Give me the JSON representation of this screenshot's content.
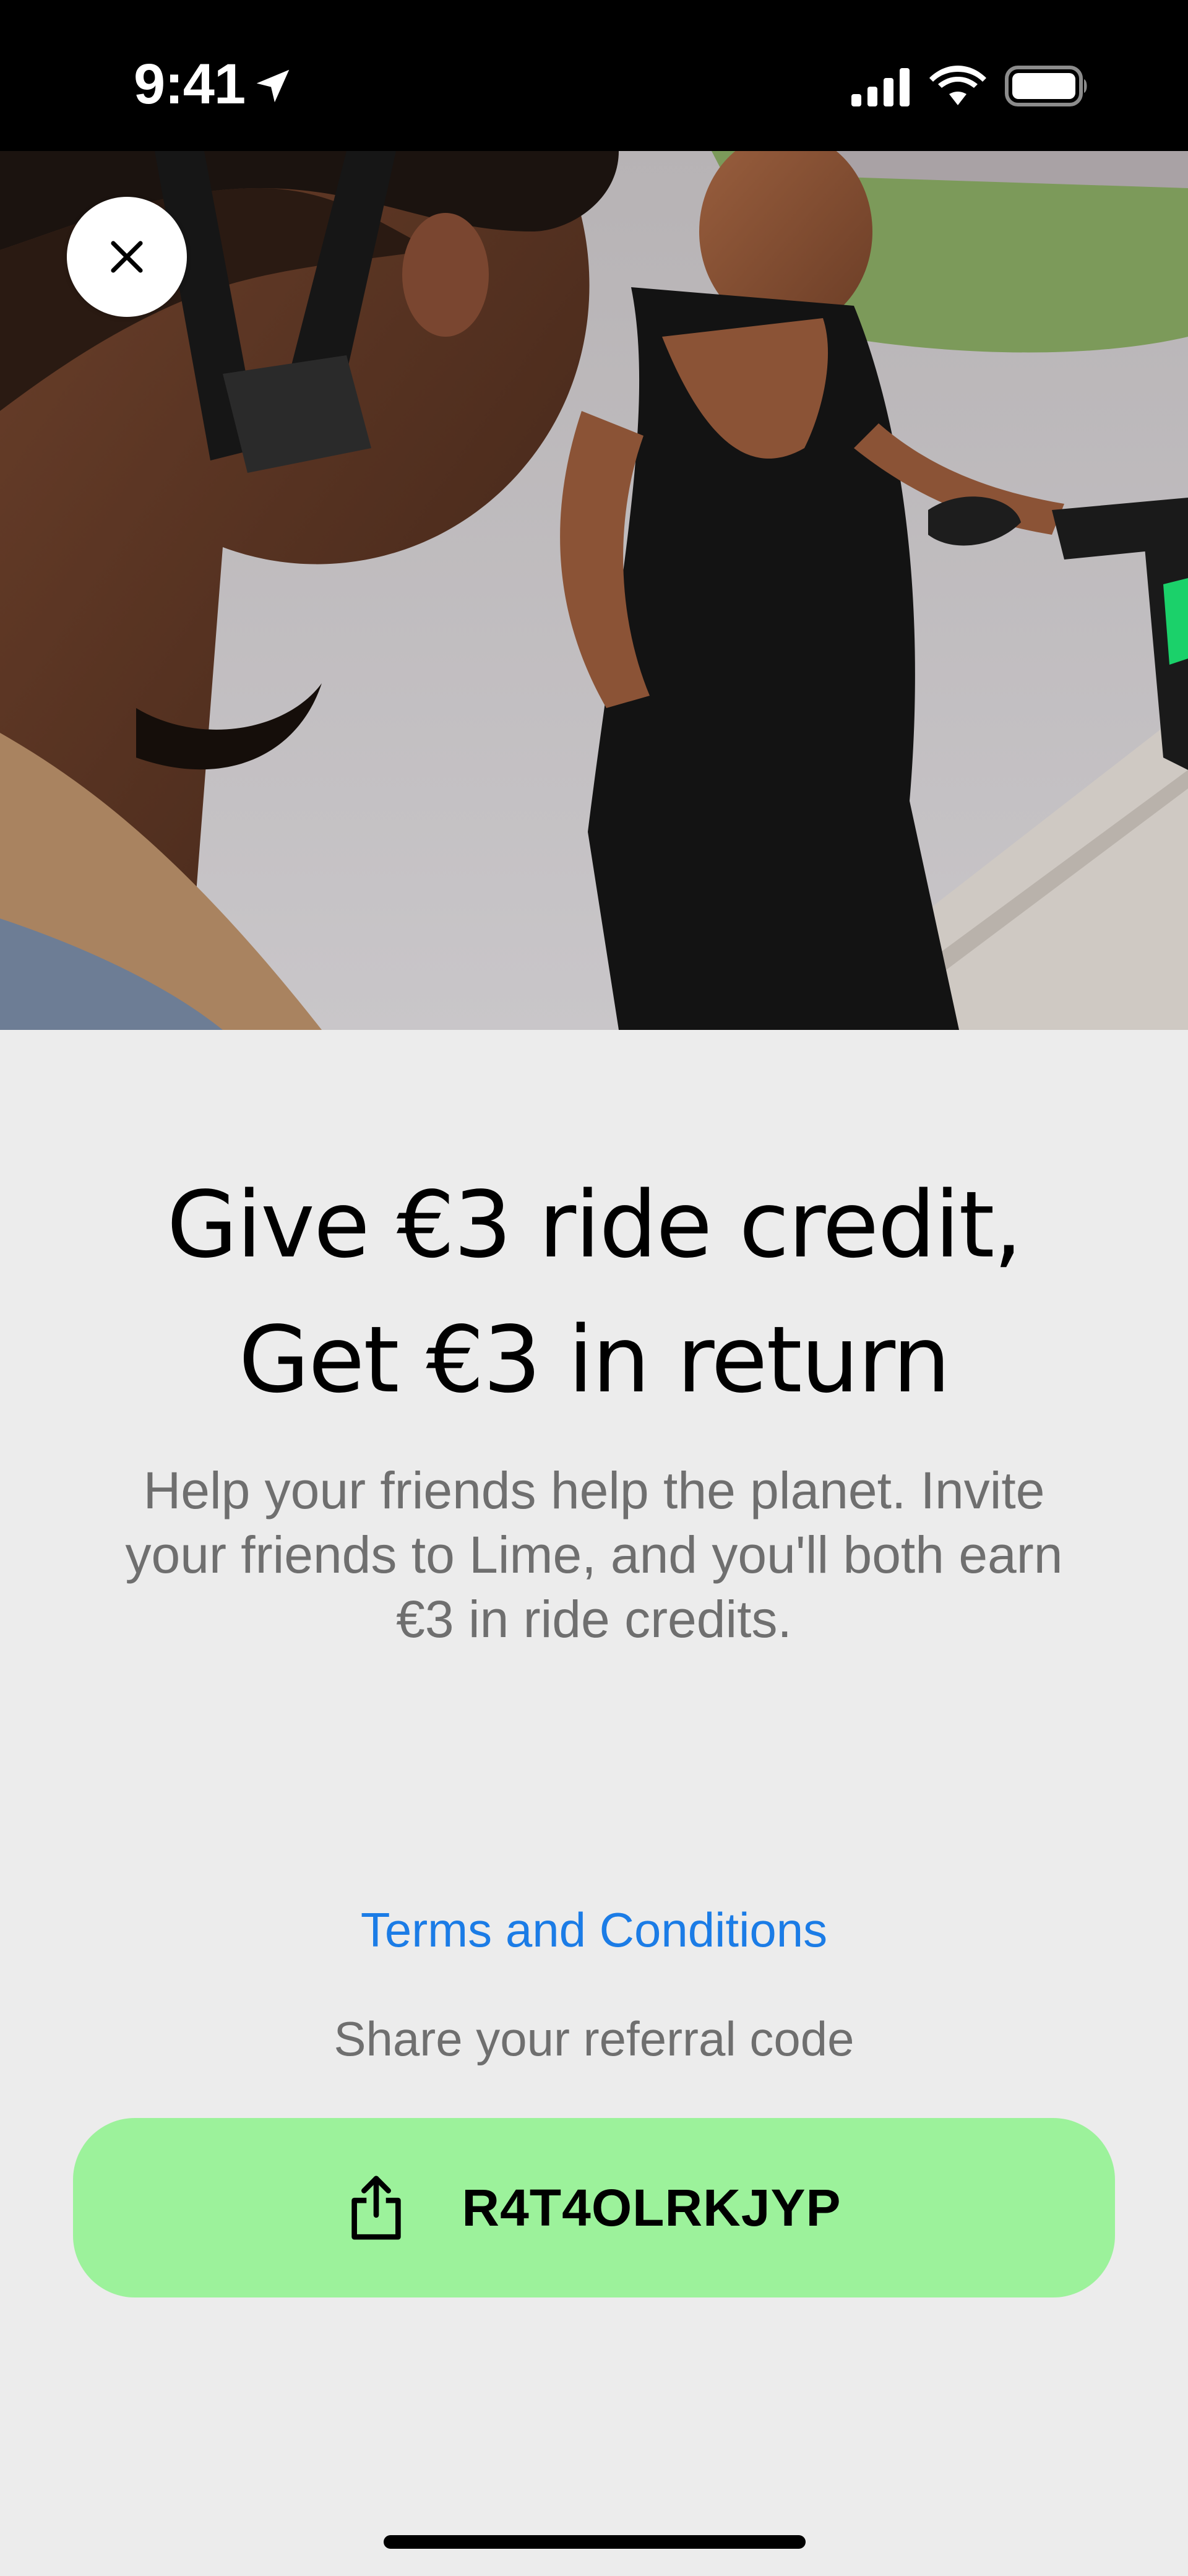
{
  "status_bar": {
    "time": "9:41",
    "icons": [
      "location-arrow-icon",
      "cellular-signal-icon",
      "wifi-icon",
      "battery-icon"
    ]
  },
  "hero": {
    "image": "photo of two people with a Lime scooter",
    "close_icon": "close-icon"
  },
  "content": {
    "headline_line1": "Give €3 ride credit,",
    "headline_line2": "Get €3 in return",
    "subtitle_line1": "Help your friends help the planet. Invite",
    "subtitle_line2": "your friends to Lime, and you'll both earn",
    "subtitle_line3": "€3 in ride credits.",
    "terms_link": "Terms and Conditions",
    "share_label": "Share your referral code",
    "referral_code": "R4T4OLRKJYP",
    "share_icon": "share-icon"
  },
  "colors": {
    "background": "#ececec",
    "accent_button": "#9cf29b",
    "link": "#1b7ce6",
    "muted_text": "#6f6f6f"
  }
}
